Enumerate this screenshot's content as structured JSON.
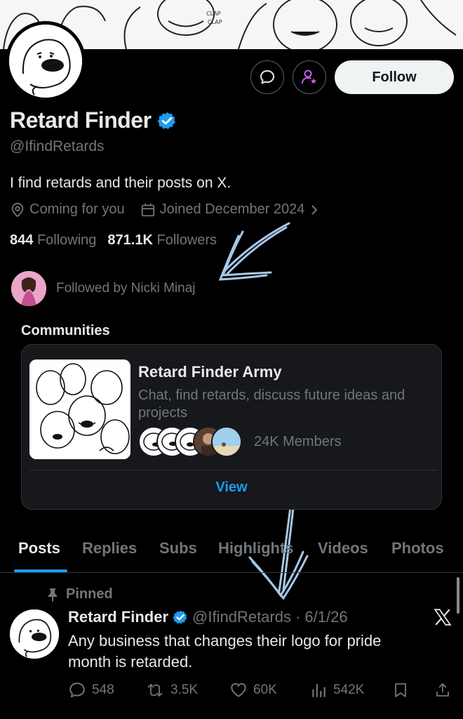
{
  "profile": {
    "name": "Retard Finder",
    "handle": "@IfindRetards",
    "bio": "I find retards and their posts on X.",
    "location": "Coming for you",
    "joined": "Joined December 2024",
    "following_count": "844",
    "following_label": "Following",
    "followers_count": "871.1K",
    "followers_label": "Followers",
    "followed_by": "Followed by Nicki Minaj",
    "verified": true
  },
  "actions": {
    "follow_label": "Follow",
    "message_icon": "message-icon",
    "subscribe_icon": "person-star-icon"
  },
  "communities": {
    "title": "Communities",
    "card": {
      "name": "Retard Finder Army",
      "description": "Chat, find retards, discuss future ideas and projects",
      "members": "24K Members",
      "view_label": "View"
    }
  },
  "tabs": [
    {
      "label": "Posts",
      "active": true
    },
    {
      "label": "Replies",
      "active": false
    },
    {
      "label": "Subs",
      "active": false
    },
    {
      "label": "Highlights",
      "active": false
    },
    {
      "label": "Videos",
      "active": false
    },
    {
      "label": "Photos",
      "active": false
    }
  ],
  "post": {
    "pinned_label": "Pinned",
    "author": "Retard Finder",
    "handle": "@IfindRetards",
    "date": "· 6/1/26",
    "text": "Any business that changes their logo for pride month is retarded.",
    "replies": "548",
    "reposts": "3.5K",
    "likes": "60K",
    "views": "542K"
  },
  "banner": {
    "caption_1": "CLAP",
    "caption_2": "CLAP"
  },
  "colors": {
    "accent": "#1d9bf0",
    "subscribe": "#c95df1",
    "background": "#000000",
    "muted_text": "#71767b",
    "annotation": "#a7c7e7"
  }
}
